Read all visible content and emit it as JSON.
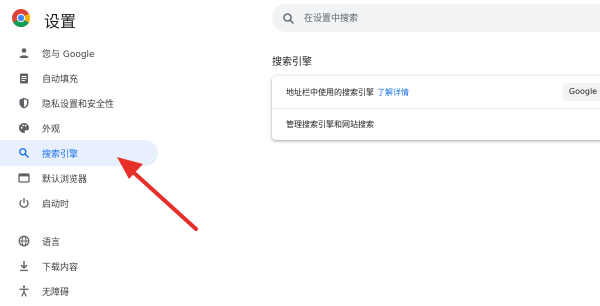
{
  "header": {
    "title": "设置",
    "search_placeholder": "在设置中搜索"
  },
  "sidebar": {
    "items": [
      {
        "label": "您与 Google",
        "icon": "person-icon"
      },
      {
        "label": "自动填充",
        "icon": "clipboard-icon"
      },
      {
        "label": "隐私设置和安全性",
        "icon": "shield-icon"
      },
      {
        "label": "外观",
        "icon": "palette-icon"
      },
      {
        "label": "搜索引擎",
        "icon": "search-icon",
        "active": true
      },
      {
        "label": "默认浏览器",
        "icon": "browser-icon"
      },
      {
        "label": "启动时",
        "icon": "power-icon"
      },
      {
        "label": "语言",
        "icon": "globe-icon"
      },
      {
        "label": "下载内容",
        "icon": "download-icon"
      },
      {
        "label": "无障碍",
        "icon": "accessibility-icon"
      }
    ]
  },
  "main": {
    "section_title": "搜索引擎",
    "rows": [
      {
        "label": "地址栏中使用的搜索引擎",
        "link": "了解详情",
        "select_value": "Google"
      },
      {
        "label": "管理搜索引擎和网站搜索"
      }
    ]
  },
  "colors": {
    "accent": "#1a73e8",
    "active_bg": "#e8f0fe",
    "annotation_arrow": "#e8302a"
  }
}
